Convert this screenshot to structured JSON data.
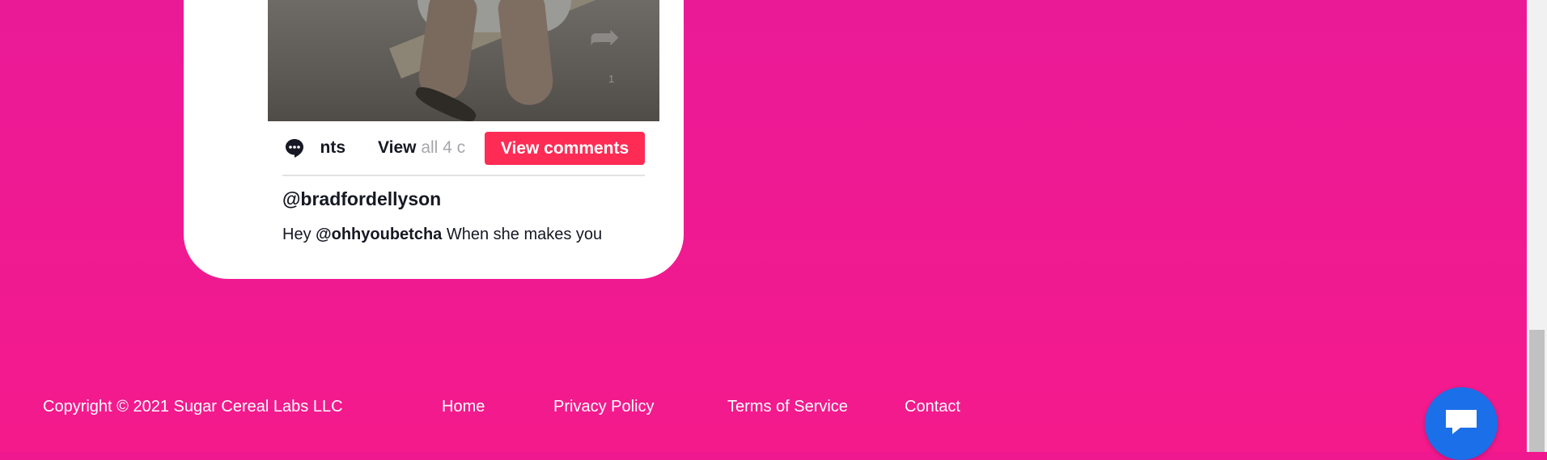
{
  "colors": {
    "background": "#f0188f",
    "accent": "#fe2c55",
    "chat_button": "#1b6fe9"
  },
  "embed": {
    "video_share_icon": "share-arrow-icon",
    "share_count": "1",
    "comments_tab_label": "nts",
    "view_all_strong": "View",
    "view_all_fade": " all 4 c",
    "view_comments_button": "View comments",
    "username": "@bradfordellyson",
    "comment_prefix": "Hey ",
    "comment_mention": "@ohhyoubetcha",
    "comment_rest": "  When she makes you",
    "comment_icon": "comment-bubble-icon"
  },
  "footer": {
    "copyright": "Copyright © 2021 Sugar Cereal Labs LLC",
    "links": [
      "Home",
      "Privacy Policy",
      "Terms of Service",
      "Contact"
    ]
  },
  "chat_widget": {
    "icon": "chat-bubble-icon"
  }
}
